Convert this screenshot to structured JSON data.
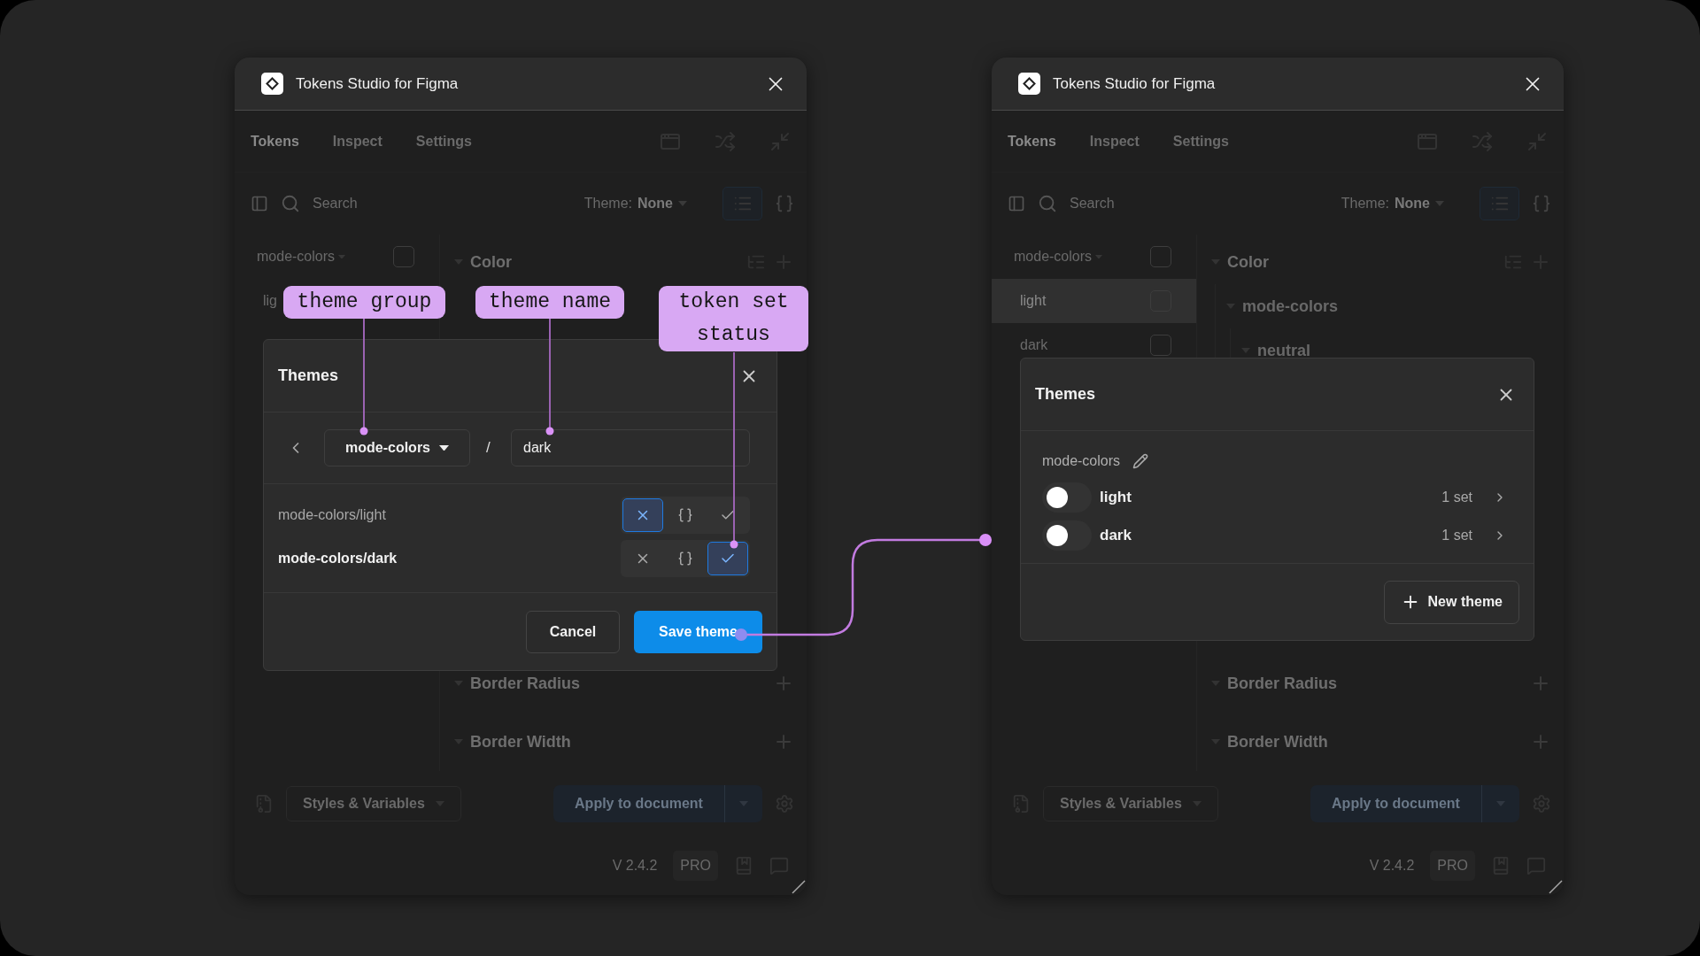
{
  "windows": [
    {
      "title": "Tokens Studio for Figma",
      "tabs": [
        {
          "label": "Tokens",
          "selected": true
        },
        {
          "label": "Inspect",
          "selected": false
        },
        {
          "label": "Settings",
          "selected": false
        }
      ],
      "search": {
        "placeholder": "Search"
      },
      "theme_select": {
        "label": "Theme:",
        "value": "None"
      },
      "sidebar": {
        "group": {
          "label": "mode-colors",
          "checked": false
        },
        "items": [
          {
            "label": "lig"
          }
        ]
      },
      "token_groups": [
        {
          "label": "Color"
        }
      ],
      "lower_groups": [
        {
          "label": "Border Radius"
        },
        {
          "label": "Border Width"
        }
      ],
      "footer": {
        "styles_select": "Styles & Variables",
        "apply_button": "Apply to document"
      },
      "status_bar": {
        "version": "V 2.4.2",
        "plan": "PRO"
      },
      "modal": {
        "kind": "edit",
        "title": "Themes",
        "group": "mode-colors",
        "name": "dark",
        "separator": "/",
        "sets": [
          {
            "name": "mode-colors/light",
            "states": [
              {
                "kind": "disabled",
                "selected": true
              },
              {
                "kind": "source",
                "selected": false
              },
              {
                "kind": "enabled",
                "selected": false
              }
            ]
          },
          {
            "name": "mode-colors/dark",
            "states": [
              {
                "kind": "disabled",
                "selected": false
              },
              {
                "kind": "source",
                "selected": false
              },
              {
                "kind": "enabled",
                "selected": true
              }
            ]
          }
        ],
        "cancel_button": "Cancel",
        "save_button": "Save theme"
      }
    },
    {
      "title": "Tokens Studio for Figma",
      "tabs": [
        {
          "label": "Tokens",
          "selected": true
        },
        {
          "label": "Inspect",
          "selected": false
        },
        {
          "label": "Settings",
          "selected": false
        }
      ],
      "search": {
        "placeholder": "Search"
      },
      "theme_select": {
        "label": "Theme:",
        "value": "None"
      },
      "sidebar": {
        "group": {
          "label": "mode-colors",
          "checked": false
        },
        "items": [
          {
            "label": "light",
            "selected": true,
            "checked": false
          },
          {
            "label": "dark",
            "selected": false,
            "checked": false
          }
        ]
      },
      "token_groups": [
        {
          "label": "Color",
          "children": [
            {
              "label": "mode-colors",
              "children": [
                {
                  "label": "neutral"
                }
              ]
            }
          ]
        }
      ],
      "lower_groups": [
        {
          "label": "Border Radius"
        },
        {
          "label": "Border Width"
        }
      ],
      "footer": {
        "styles_select": "Styles & Variables",
        "apply_button": "Apply to document"
      },
      "status_bar": {
        "version": "V 2.4.2",
        "plan": "PRO"
      },
      "modal": {
        "kind": "list",
        "title": "Themes",
        "group": "mode-colors",
        "themes": [
          {
            "name": "light",
            "on": false,
            "count": "1 set"
          },
          {
            "name": "dark",
            "on": false,
            "count": "1 set"
          }
        ],
        "new_button": "New theme"
      }
    }
  ],
  "annotations": [
    {
      "label": "theme group"
    },
    {
      "label": "theme name"
    },
    {
      "label": "token set status"
    }
  ]
}
